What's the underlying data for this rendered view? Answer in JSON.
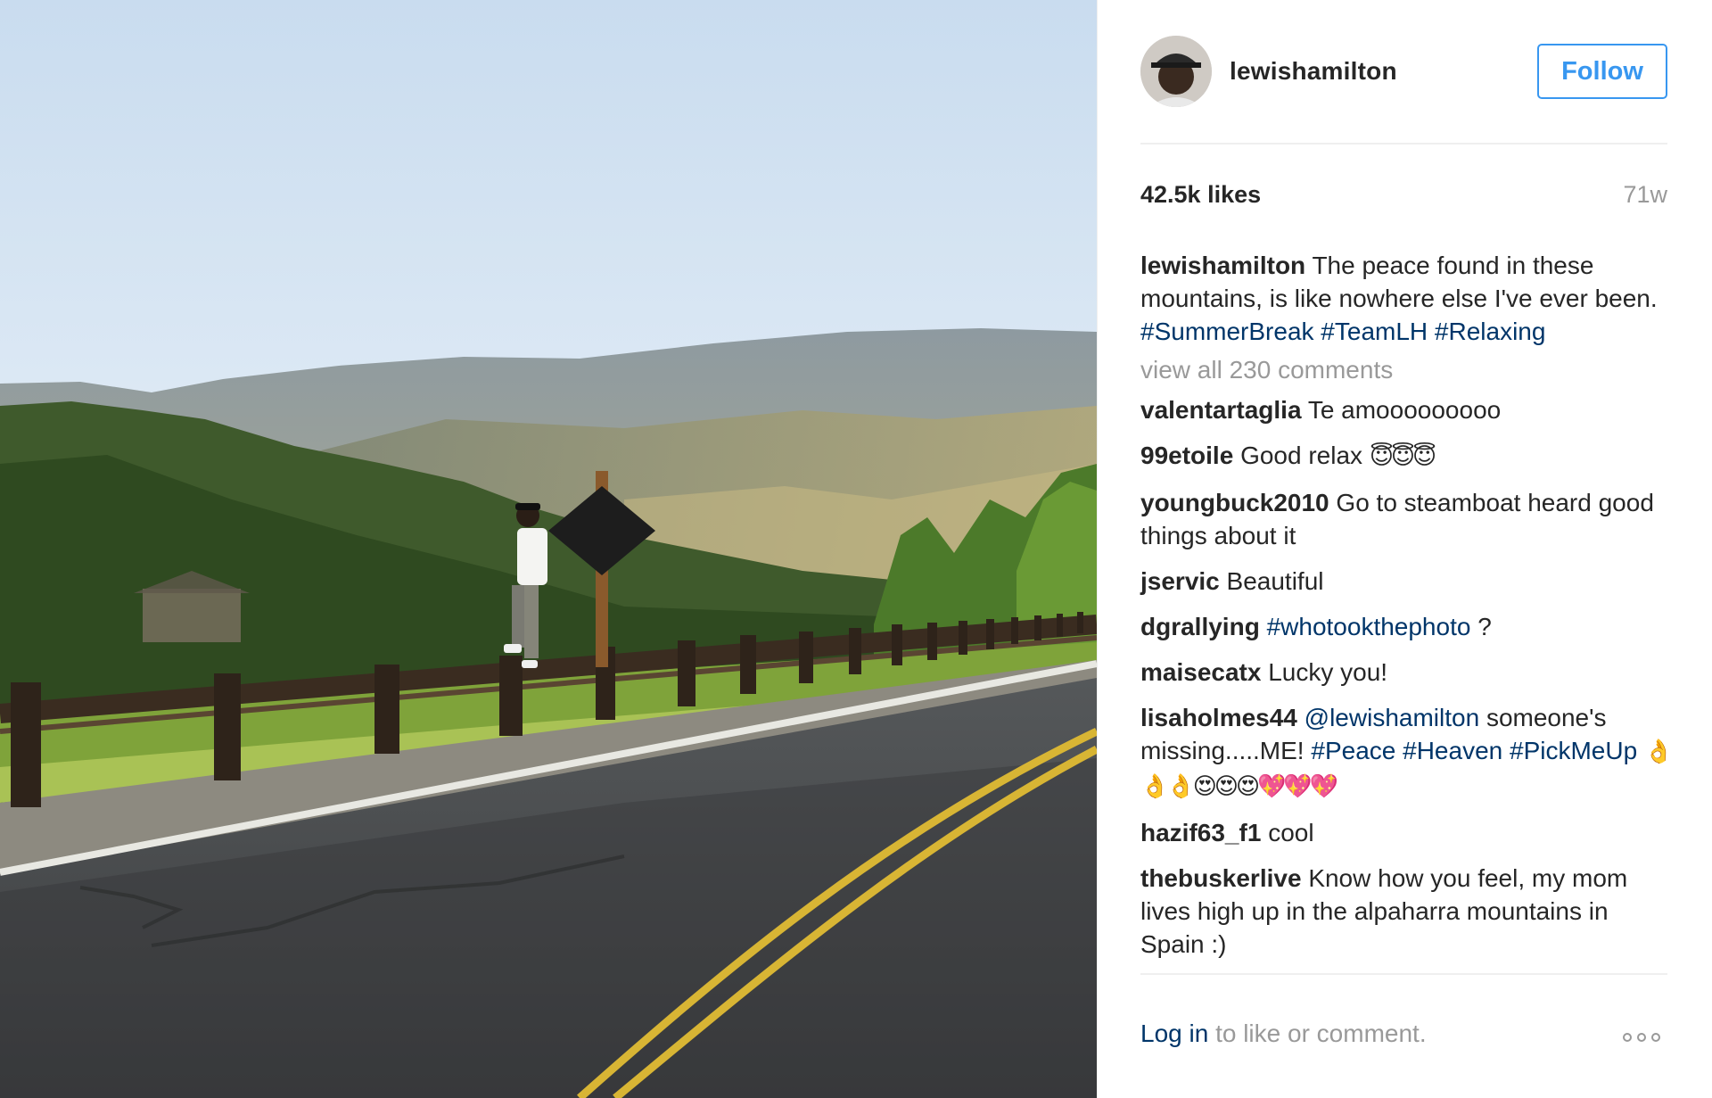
{
  "post": {
    "photo": {
      "alt": "Man standing on wooden guardrail beside mountain road at sunset"
    },
    "header": {
      "username": "lewishamilton",
      "follow_label": "Follow"
    },
    "stats": {
      "likes": "42.5k likes",
      "age": "71w"
    },
    "caption": {
      "username": "lewishamilton",
      "text": "The peace found in these mountains, is like nowhere else I've ever been.",
      "hashtags": [
        "#SummerBreak",
        "#TeamLH",
        "#Relaxing"
      ]
    },
    "view_all_comments": "view all 230 comments",
    "comments": [
      {
        "user": "valentartaglia",
        "text": "Te amooooooooo"
      },
      {
        "user": "99etoile",
        "text": "Good relax",
        "emoji": "😇😇😇"
      },
      {
        "user": "youngbuck2010",
        "text": "Go to steamboat heard good things about it"
      },
      {
        "user": "jservic",
        "text": "Beautiful"
      },
      {
        "user": "dgrallying",
        "tag": "#whotookthephoto",
        "text": "?"
      },
      {
        "user": "maisecatx",
        "text": "Lucky you!"
      },
      {
        "user": "lisaholmes44",
        "mention": "@lewishamilton",
        "text_a": "someone's missing.....ME!",
        "tags": [
          "#Peace",
          "#Heaven",
          "#PickMeUp"
        ],
        "emoji": "👌👌👌😍😍😍💖💖💖"
      },
      {
        "user": "hazif63_f1",
        "text": "cool"
      },
      {
        "user": "thebuskerlive",
        "text": "Know how you feel, my mom lives high up in the alpaharra mountains in Spain :)"
      }
    ],
    "footer": {
      "login_link": "Log in",
      "login_rest": "to like or comment."
    },
    "colors": {
      "link_blue": "#3897f0",
      "tag_blue": "#003569",
      "muted": "#999999"
    }
  }
}
